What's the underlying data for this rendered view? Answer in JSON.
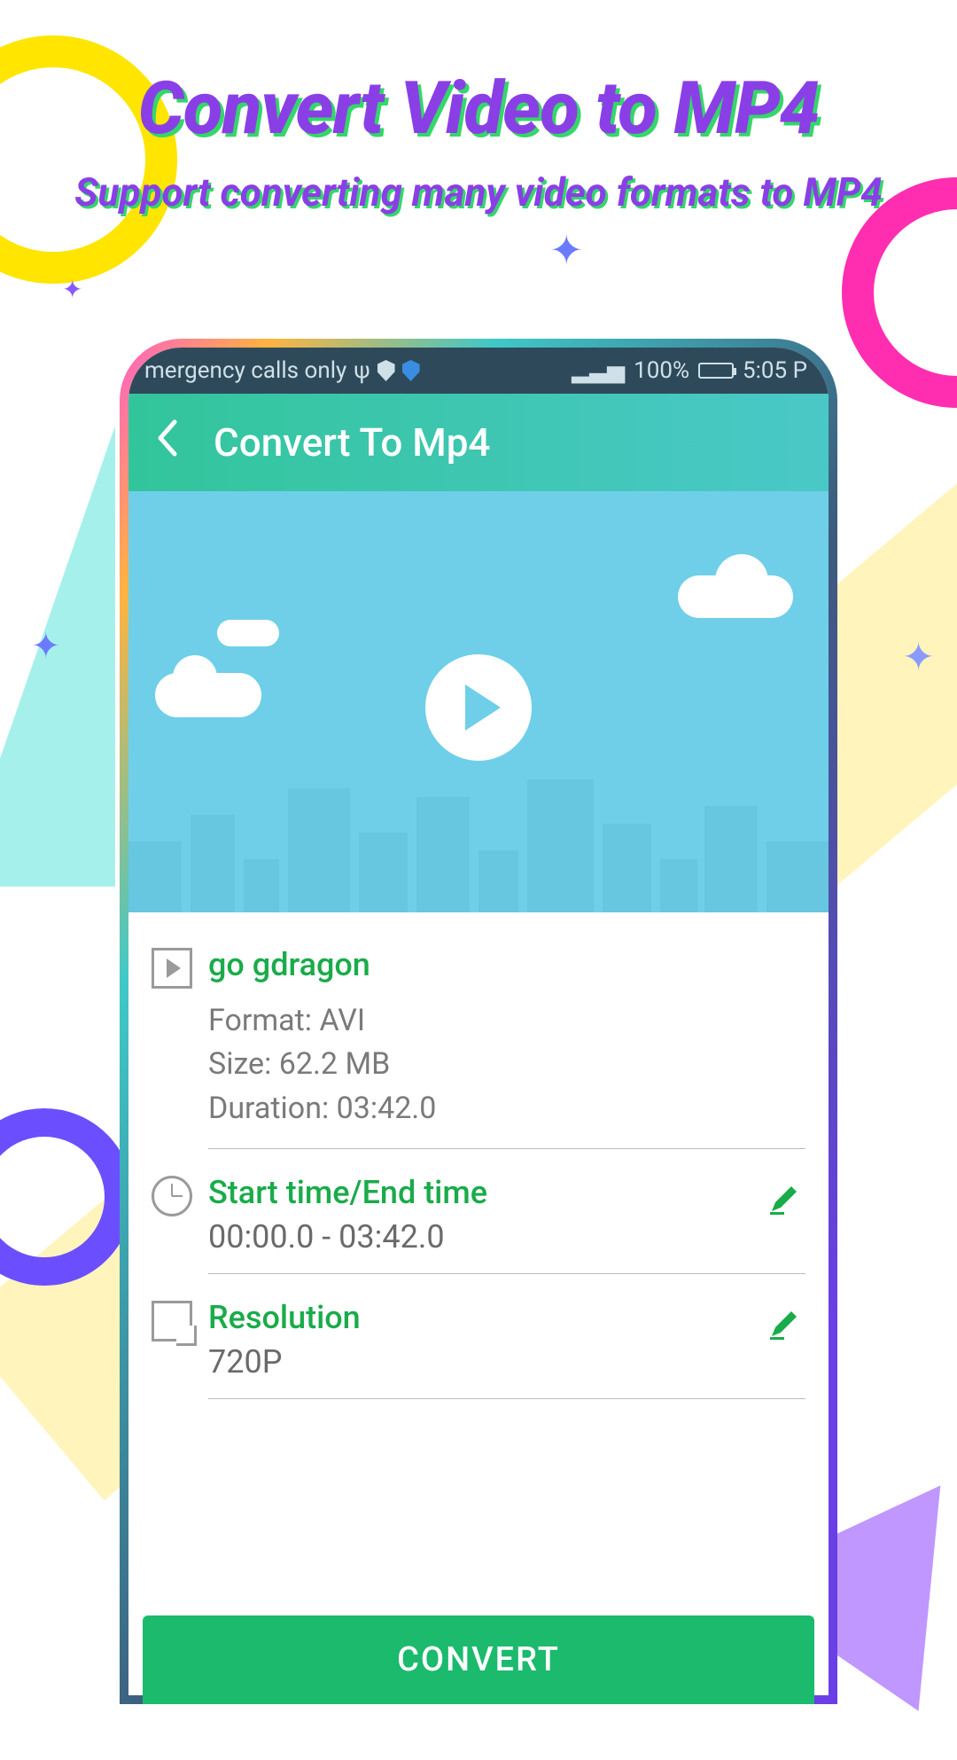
{
  "promo": {
    "title": "Convert Video to MP4",
    "subtitle": "Support converting many video formats to MP4"
  },
  "status_bar": {
    "network_text": "mergency calls only",
    "battery_pct": "100%",
    "time": "5:05 P"
  },
  "app_bar": {
    "title": "Convert To Mp4"
  },
  "file": {
    "name": "go gdragon",
    "format_label": "Format: AVI",
    "size_label": "Size: 62.2 MB",
    "duration_label": "Duration: 03:42.0"
  },
  "time_range": {
    "label": "Start time/End time",
    "value": "00:00.0 - 03:42.0"
  },
  "resolution": {
    "label": "Resolution",
    "value": "720P"
  },
  "convert_button": "CONVERT"
}
